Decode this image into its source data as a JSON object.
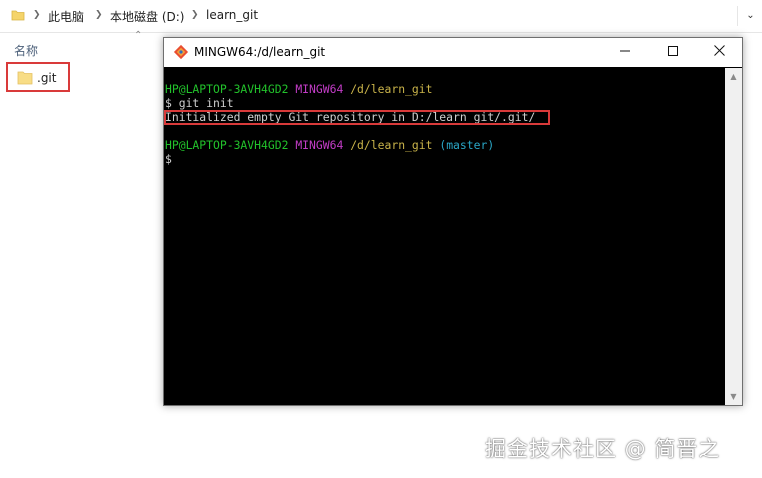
{
  "explorer": {
    "breadcrumbs": [
      "此电脑",
      "本地磁盘 (D:)",
      "learn_git"
    ],
    "column_header": "名称",
    "items": [
      {
        "name": ".git",
        "icon": "folder-icon"
      }
    ]
  },
  "terminal": {
    "title": "MINGW64:/d/learn_git",
    "lines": [
      {
        "user": "HP@LAPTOP-3AVH4GD2",
        "shell": "MINGW64",
        "path": "/d/learn_git",
        "branch": ""
      },
      {
        "text": "$ git init"
      },
      {
        "text": "Initialized empty Git repository in D:/learn_git/.git/"
      },
      {
        "user": "HP@LAPTOP-3AVH4GD2",
        "shell": "MINGW64",
        "path": "/d/learn_git",
        "branch": "(master)"
      },
      {
        "text": "$"
      }
    ],
    "colors": {
      "user": "#22c22b",
      "shell": "#c23cc6",
      "path": "#c9b34a",
      "branch": "#2aa7c7"
    }
  },
  "watermark": "掘金技术社区 @ 简晋之"
}
